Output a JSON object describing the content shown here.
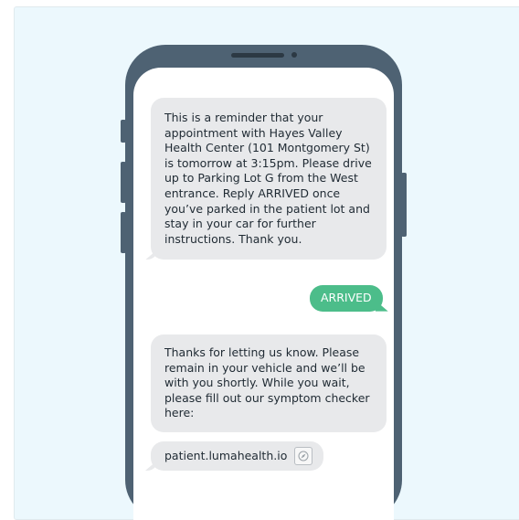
{
  "messages": {
    "reminder": "This is a reminder that your appointment with Hayes Valley Health Center (101 Montgomery St) is tomorrow at 3:15pm. Please drive up to Parking Lot G from the West entrance. Reply ARRIVED once you’ve parked in the patient lot and stay in your car for further instructions. Thank you.",
    "reply": "ARRIVED",
    "response": "Thanks for letting us know. Please remain in your vehicle and we’ll be with you shortly. While you wait, please fill out our symptom checker here:",
    "link": "patient.lumahealth.io"
  },
  "icons": {
    "link_icon": "compass-icon"
  },
  "colors": {
    "panel_bg": "#ecf8fd",
    "phone_frame": "#4e6273",
    "incoming_bubble": "#e8e9eb",
    "outgoing_bubble": "#4cbd8a"
  }
}
